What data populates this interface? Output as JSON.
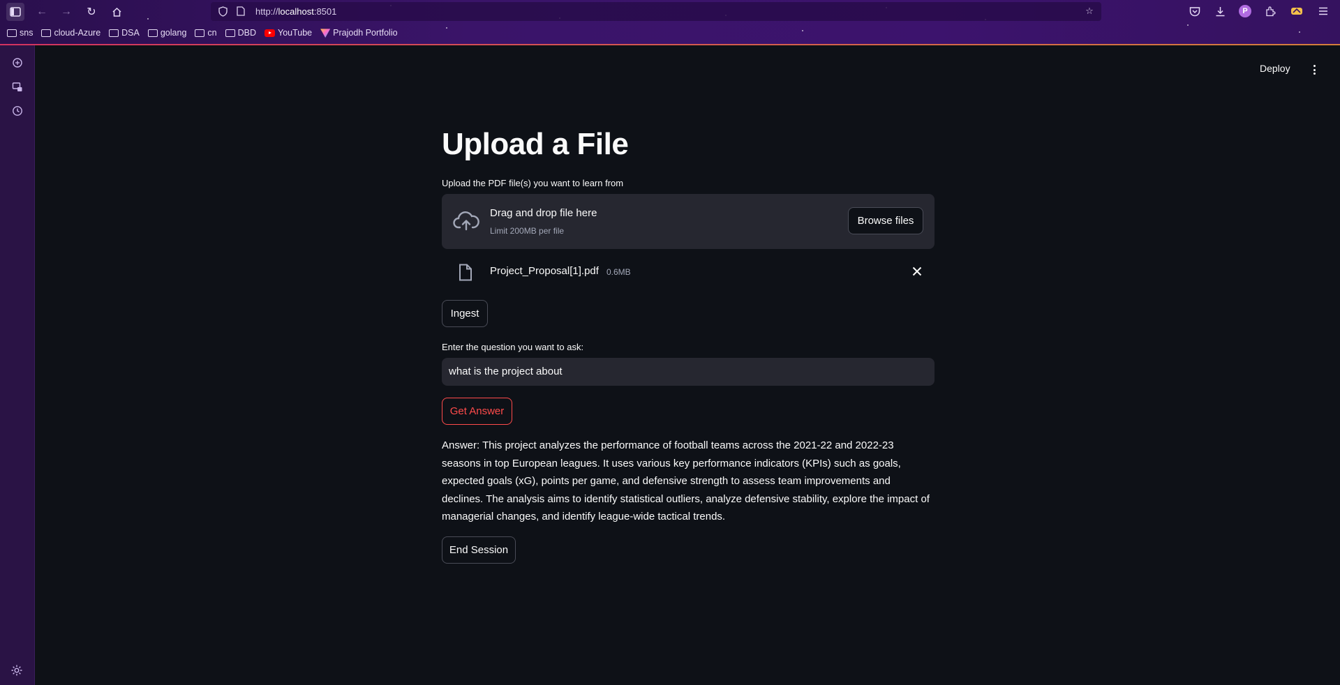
{
  "browser": {
    "url_prefix": "http://",
    "url_host": "localhost",
    "url_port": ":8501",
    "bookmarks": [
      {
        "label": "sns",
        "icon": "folder-icon"
      },
      {
        "label": "cloud-Azure",
        "icon": "folder-icon"
      },
      {
        "label": "DSA",
        "icon": "folder-icon"
      },
      {
        "label": "golang",
        "icon": "folder-icon"
      },
      {
        "label": "cn",
        "icon": "folder-icon"
      },
      {
        "label": "DBD",
        "icon": "folder-icon"
      },
      {
        "label": "YouTube",
        "icon": "youtube-icon"
      },
      {
        "label": "Prajodh Portfolio",
        "icon": "portfolio-icon"
      }
    ],
    "profile_initial": "P"
  },
  "header": {
    "deploy_label": "Deploy"
  },
  "main": {
    "title": "Upload a File",
    "upload_label": "Upload the PDF file(s) you want to learn from",
    "dropzone": {
      "title": "Drag and drop file here",
      "limit": "Limit 200MB per file",
      "browse_label": "Browse files"
    },
    "file": {
      "name": "Project_Proposal[1].pdf",
      "size": "0.6MB"
    },
    "ingest_label": "Ingest",
    "question_label": "Enter the question you want to ask:",
    "question_value": "what is the project about",
    "get_answer_label": "Get Answer",
    "answer": "Answer: This project analyzes the performance of football teams across the 2021-22 and 2022-23 seasons in top European leagues. It uses various key performance indicators (KPIs) such as goals, expected goals (xG), points per game, and defensive strength to assess team improvements and declines. The analysis aims to identify statistical outliers, analyze defensive stability, explore the impact of managerial changes, and identify league-wide tactical trends.",
    "end_session_label": "End Session"
  },
  "colors": {
    "accent": "#ff4b4b",
    "background": "#0e1117",
    "surface": "#262730"
  }
}
